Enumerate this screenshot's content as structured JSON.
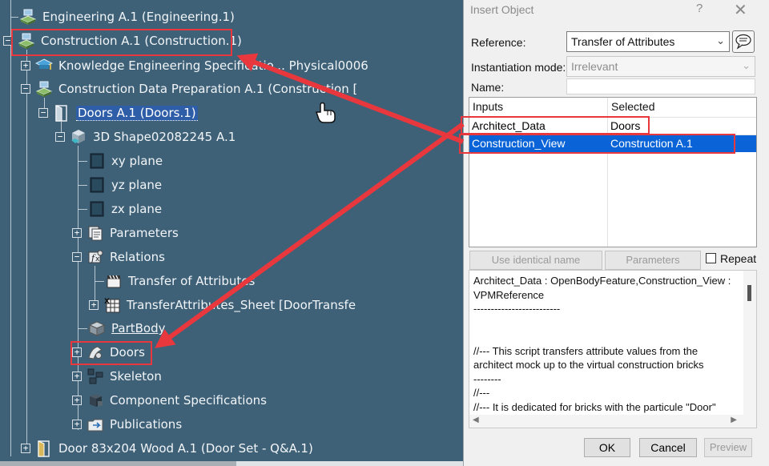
{
  "tree": {
    "nodes": [
      {
        "id": "eng",
        "label": "Engineering A.1 (Engineering.1)",
        "icon": "product-icon"
      },
      {
        "id": "construction",
        "label": "Construction A.1 (Construction.1)",
        "icon": "product-icon"
      },
      {
        "id": "knowledge",
        "label": "Knowledge Engineering Specificatio... Physical0006",
        "icon": "knowledge-icon"
      },
      {
        "id": "cdp",
        "label": "Construction Data Preparation A.1 (Construction [",
        "icon": "product-icon"
      },
      {
        "id": "doors-a1",
        "label": "Doors A.1 (Doors.1)",
        "icon": "door-icon"
      },
      {
        "id": "shape",
        "label": "3D Shape02082245 A.1",
        "icon": "3dshape-icon"
      },
      {
        "id": "xy",
        "label": "xy plane",
        "icon": "plane-icon"
      },
      {
        "id": "yz",
        "label": "yz plane",
        "icon": "plane-icon"
      },
      {
        "id": "zx",
        "label": "zx plane",
        "icon": "plane-icon"
      },
      {
        "id": "params",
        "label": "Parameters",
        "icon": "parameters-icon"
      },
      {
        "id": "relations",
        "label": "Relations",
        "icon": "relations-icon"
      },
      {
        "id": "toa",
        "label": "Transfer of Attributes",
        "icon": "clapperboard-icon"
      },
      {
        "id": "sheet",
        "label": "TransferAttributes_Sheet [DoorTransfe",
        "icon": "sheet-icon"
      },
      {
        "id": "partbody",
        "label": "PartBody",
        "icon": "partbody-icon"
      },
      {
        "id": "doors",
        "label": "Doors",
        "icon": "geoset-icon"
      },
      {
        "id": "skeleton",
        "label": "Skeleton",
        "icon": "skeleton-icon"
      },
      {
        "id": "compspec",
        "label": "Component Specifications",
        "icon": "component-icon"
      },
      {
        "id": "pubs",
        "label": "Publications",
        "icon": "publications-icon"
      },
      {
        "id": "door83",
        "label": "Door 83x204 Wood A.1 (Door Set - Q&A.1)",
        "icon": "door-icon"
      }
    ]
  },
  "dialog": {
    "title": "Insert Object",
    "help_glyph": "?",
    "close_glyph": "✕",
    "reference_label": "Reference:",
    "reference_value": "Transfer of Attributes",
    "instantiation_label": "Instantiation mode:",
    "instantiation_value": "Irrelevant",
    "name_label": "Name:",
    "name_value": "",
    "table": {
      "headers": [
        "Inputs",
        "Selected"
      ],
      "rows": [
        {
          "input": "Architect_Data",
          "selected": "Doors"
        },
        {
          "input": "Construction_View",
          "selected": "Construction A.1"
        }
      ]
    },
    "use_identical_name_label": "Use identical name",
    "parameters_label": "Parameters",
    "repeat_label": "Repeat",
    "description_lines": [
      "Architect_Data :  OpenBodyFeature,Construction_View :",
      "VPMReference",
      "-------------------------",
      "",
      "",
      "//--- This script transfers attribute values from the",
      "architect mock up to the virtual construction bricks",
      "--------",
      "//---",
      "//--- It is dedicated for bricks with the particule \"Door\""
    ],
    "ok_label": "OK",
    "cancel_label": "Cancel",
    "preview_label": "Preview"
  },
  "colors": {
    "background": "#3f6178",
    "highlight_red": "#e8383d",
    "selection_blue": "#0a64d8"
  }
}
